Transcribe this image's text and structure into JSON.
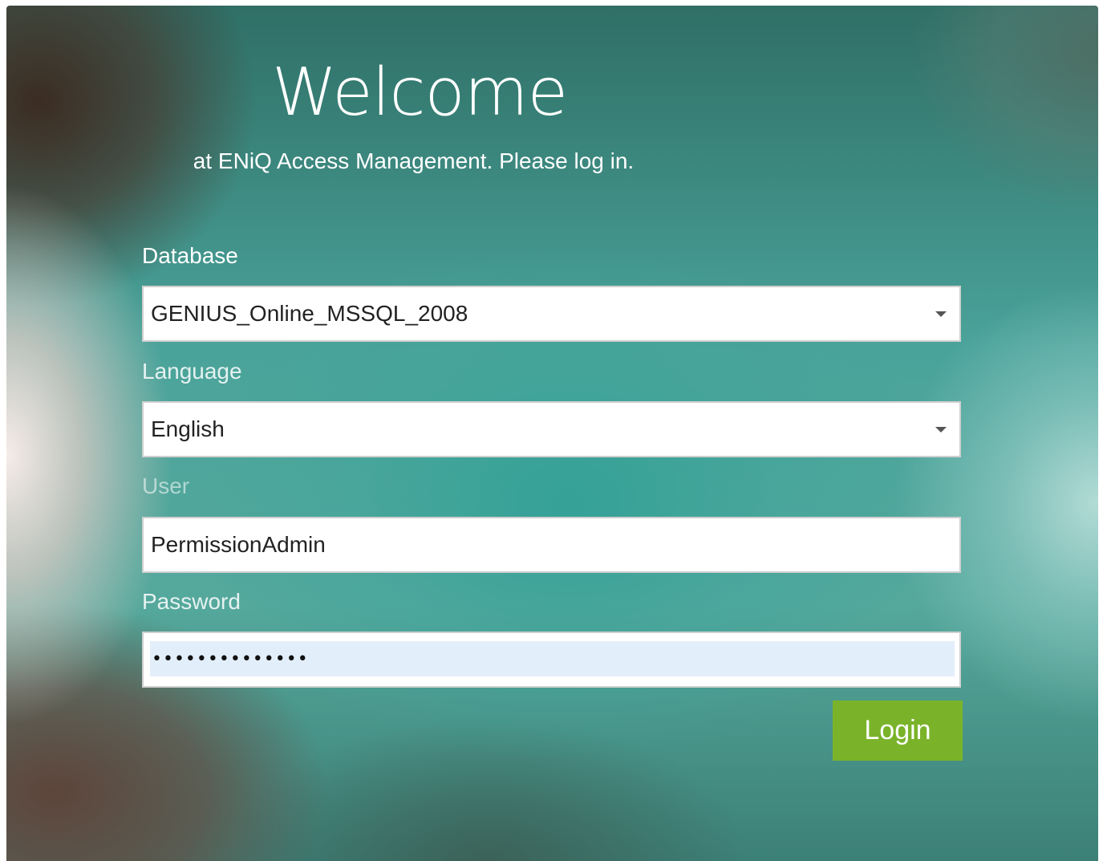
{
  "header": {
    "title": "Welcome",
    "subtitle": "at ENiQ Access Management. Please log in."
  },
  "form": {
    "database": {
      "label": "Database",
      "value": "GENIUS_Online_MSSQL_2008"
    },
    "language": {
      "label": "Language",
      "value": "English"
    },
    "user": {
      "label": "User",
      "value": "PermissionAdmin"
    },
    "password": {
      "label": "Password",
      "value": "••••••••••••••"
    },
    "login_label": "Login"
  },
  "colors": {
    "login_button": "#7ab32a",
    "input_background": "#ffffff",
    "password_autofill_background": "#e3eefb"
  },
  "icons": {
    "dropdown": "chevron-down-icon"
  }
}
